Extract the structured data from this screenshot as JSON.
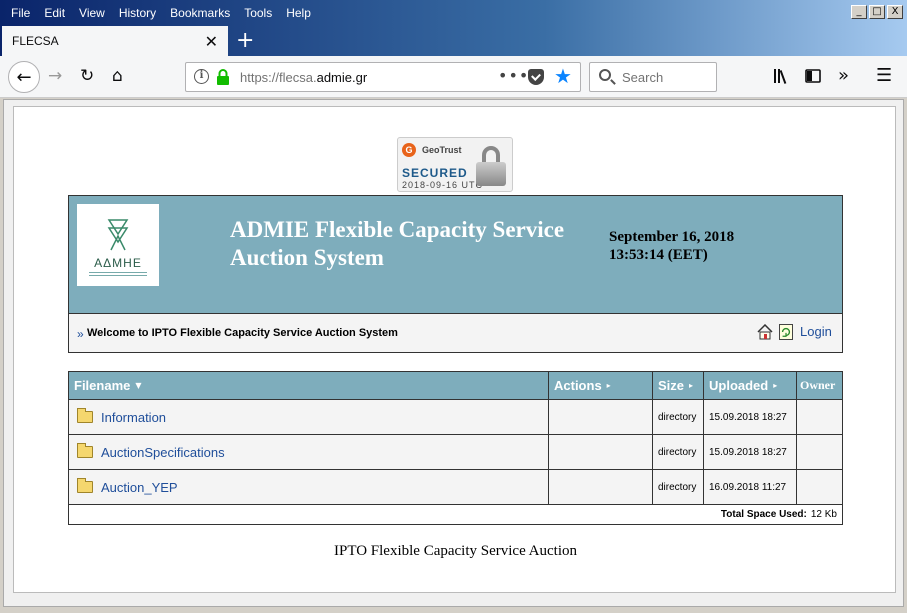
{
  "menu": [
    "File",
    "Edit",
    "View",
    "History",
    "Bookmarks",
    "Tools",
    "Help"
  ],
  "window_controls": [
    "_",
    "□",
    "X"
  ],
  "tab": {
    "title": "FLECSA",
    "close": "✕",
    "new": "+"
  },
  "nav": {
    "url_prefix": "https://flecsa.",
    "url_host": "admie.gr",
    "search_placeholder": "Search"
  },
  "badge": {
    "brand": "GeoTrust",
    "secured": "SECURED",
    "date": "2018-09-16 UTC"
  },
  "header": {
    "logo_text": "ΑΔΜΗΕ",
    "title_line1": "ADMIE Flexible Capacity Service",
    "title_line2": "Auction System",
    "date": "September 16, 2018",
    "time": "13:53:14 (EET)"
  },
  "welcome": {
    "arrow": "»",
    "text": "Welcome to IPTO Flexible Capacity Service Auction System",
    "login": "Login"
  },
  "table": {
    "headers": [
      "Filename",
      "Actions",
      "Size",
      "Uploaded",
      "Owner"
    ],
    "rows": [
      {
        "name": "Information",
        "actions": "",
        "size": "directory",
        "uploaded": "15.09.2018 18:27",
        "owner": ""
      },
      {
        "name": "AuctionSpecifications",
        "actions": "",
        "size": "directory",
        "uploaded": "15.09.2018 18:27",
        "owner": ""
      },
      {
        "name": "Auction_YEP",
        "actions": "",
        "size": "directory",
        "uploaded": "16.09.2018 11:27",
        "owner": ""
      }
    ],
    "total_label": "Total Space Used:",
    "total_value": "12 Kb"
  },
  "footer": "IPTO Flexible Capacity Service Auction",
  "colors": {
    "header_bg": "#7eadbc",
    "link": "#1f4e9a",
    "accent_blue": "#0a84ff"
  }
}
